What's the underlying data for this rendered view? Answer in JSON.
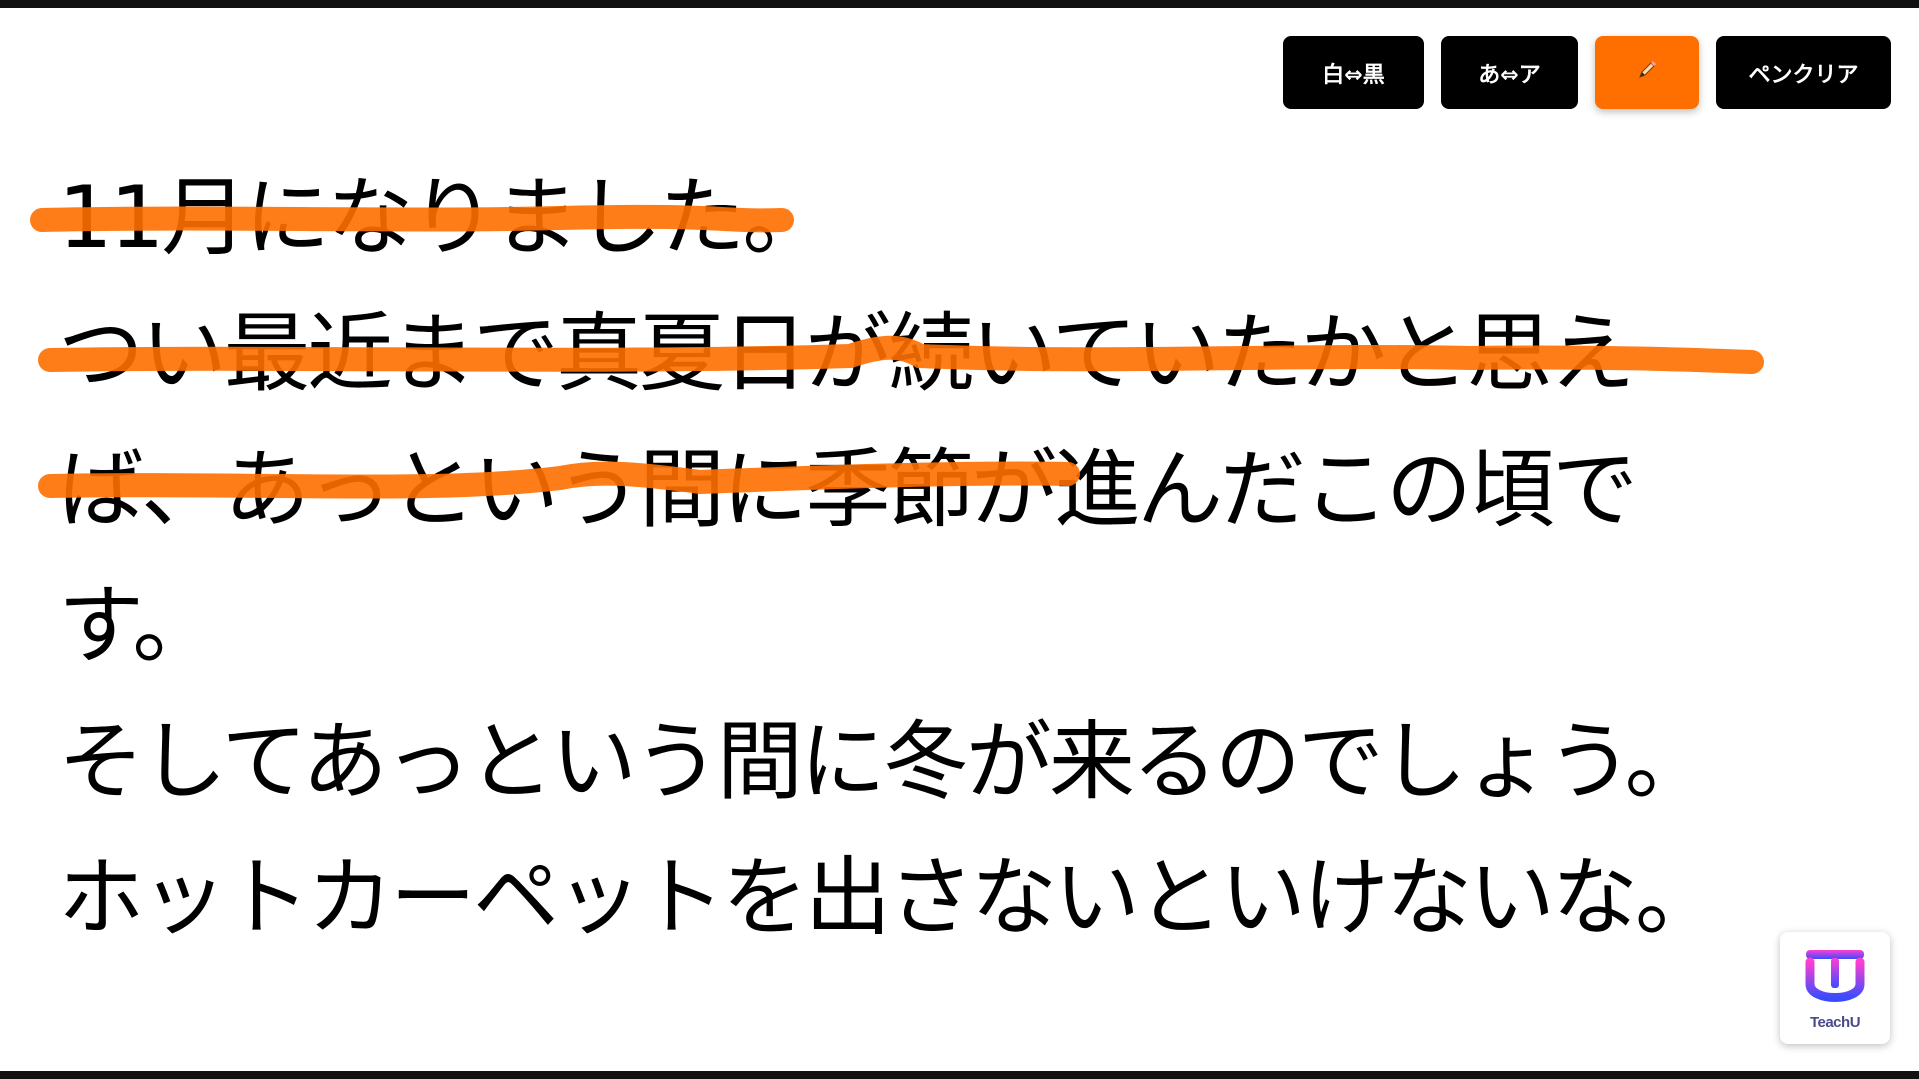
{
  "toolbar": {
    "invert_label": "白⇔黒",
    "kana_label": "あ⇔ア",
    "pen_icon": "pencil-icon",
    "clear_label": "ペンクリア"
  },
  "lines": [
    "11月になりました。",
    "つい最近まで真夏日が続いていたかと思え",
    "ば、あっという間に季節が進んだこの頃で",
    "す。",
    "そしてあっという間に冬が来るのでしょう。",
    "ホットカーペットを出さないといけないな。"
  ],
  "logo": {
    "text": "TeachU"
  },
  "colors": {
    "pen": "#ff6f00",
    "button": "#000000",
    "text": "#000000"
  }
}
